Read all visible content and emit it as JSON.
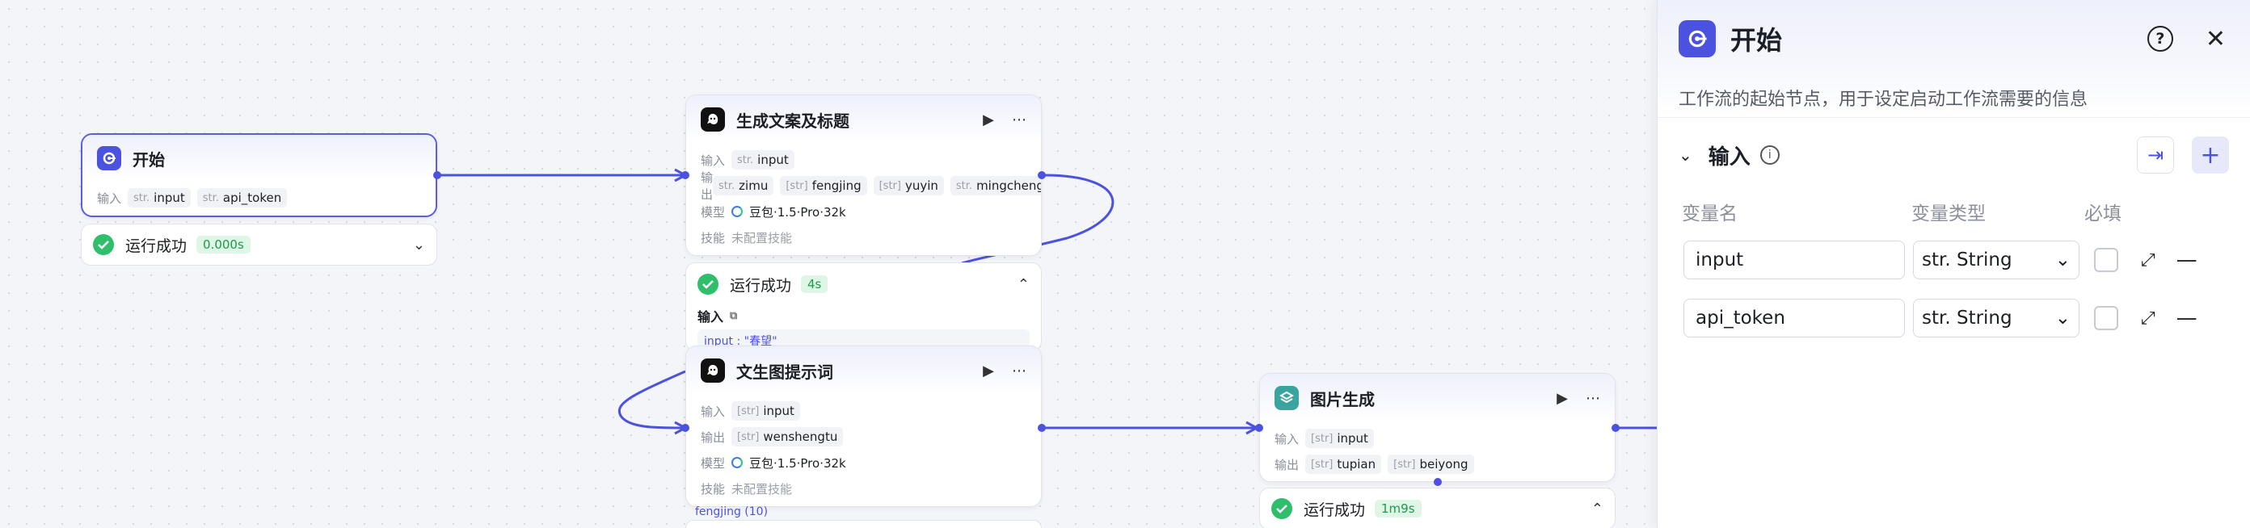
{
  "nodes": {
    "start": {
      "title": "开始",
      "input_label": "输入",
      "inputs": [
        {
          "type": "str.",
          "name": "input"
        },
        {
          "type": "str.",
          "name": "api_token"
        }
      ],
      "status": {
        "text": "运行成功",
        "time": "0.000s"
      }
    },
    "copy": {
      "title": "生成文案及标题",
      "input_label": "输入",
      "inputs": [
        {
          "type": "str.",
          "name": "input"
        }
      ],
      "output_label": "输出",
      "outputs": [
        {
          "type": "str.",
          "name": "zimu"
        },
        {
          "type": "[str]",
          "name": "fengjing"
        },
        {
          "type": "[str]",
          "name": "yuyin"
        },
        {
          "type": "str.",
          "name": "mingcheng"
        }
      ],
      "model_label": "模型",
      "model": "豆包·1.5·Pro·32k",
      "skill_label": "技能",
      "skill": "未配置技能",
      "status": {
        "text": "运行成功",
        "time": "4s",
        "input_label": "输入",
        "preview": "input : \"春望\""
      }
    },
    "prompt": {
      "title": "文生图提示词",
      "input_label": "输入",
      "inputs": [
        {
          "type": "[str]",
          "name": "input"
        }
      ],
      "output_label": "输出",
      "outputs": [
        {
          "type": "[str]",
          "name": "wenshengtu"
        }
      ],
      "model_label": "模型",
      "model": "豆包·1.5·Pro·32k",
      "skill_label": "技能",
      "skill": "未配置技能",
      "footer": "fengjing (10)"
    },
    "image": {
      "title": "图片生成",
      "input_label": "输入",
      "inputs": [
        {
          "type": "[str]",
          "name": "input"
        }
      ],
      "output_label": "输出",
      "outputs": [
        {
          "type": "[str]",
          "name": "tupian"
        },
        {
          "type": "[str]",
          "name": "beiyong"
        }
      ],
      "status": {
        "text": "运行成功",
        "time": "1m9s"
      }
    }
  },
  "panel": {
    "title": "开始",
    "description": "工作流的起始节点，用于设定启动工作流需要的信息",
    "section_title": "输入",
    "columns": [
      "变量名",
      "变量类型",
      "必填"
    ],
    "variables": [
      {
        "name": "input",
        "type": "str. String",
        "required": false
      },
      {
        "name": "api_token",
        "type": "str. String",
        "required": false
      }
    ]
  },
  "icons": [
    "start-node-icon",
    "llm-node-icon",
    "image-node-icon",
    "play-icon",
    "more-icon",
    "success-check-icon",
    "chevron-down-icon",
    "chevron-up-icon",
    "help-icon",
    "close-icon",
    "info-icon",
    "import-icon",
    "plus-icon",
    "expand-icon",
    "minus-icon",
    "copy-icon"
  ],
  "colors": {
    "accent": "#4c52e0",
    "success": "#2fbf6b"
  }
}
